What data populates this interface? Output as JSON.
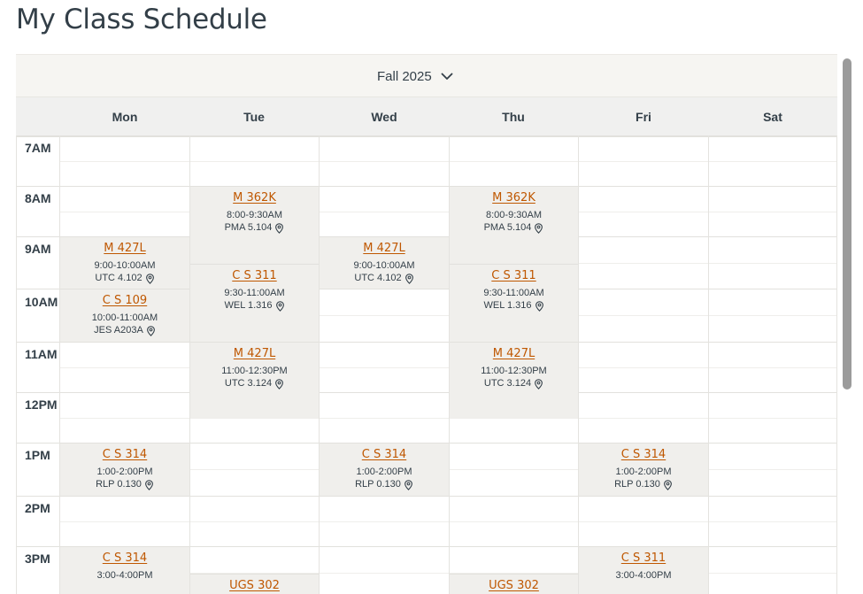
{
  "page": {
    "title": "My Class Schedule"
  },
  "term": {
    "label": "Fall 2025",
    "icon": "chevron-down-icon"
  },
  "days": [
    "Mon",
    "Tue",
    "Wed",
    "Thu",
    "Fri",
    "Sat"
  ],
  "times": [
    "7AM",
    "8AM",
    "9AM",
    "10AM",
    "11AM",
    "12PM",
    "1PM",
    "2PM",
    "3PM"
  ],
  "colors": {
    "accent": "#bf5700",
    "event_bg": "#f0efec",
    "text": "#333f48"
  },
  "events": [
    {
      "title": "M 362K",
      "time": "8:00-9:30AM",
      "location": "PMA 5.104"
    },
    {
      "title": "M 362K",
      "time": "8:00-9:30AM",
      "location": "PMA 5.104"
    },
    {
      "title": "M 427L",
      "time": "9:00-10:00AM",
      "location": "UTC 4.102"
    },
    {
      "title": "M 427L",
      "time": "9:00-10:00AM",
      "location": "UTC 4.102"
    },
    {
      "title": "C S 311",
      "time": "9:30-11:00AM",
      "location": "WEL 1.316"
    },
    {
      "title": "C S 311",
      "time": "9:30-11:00AM",
      "location": "WEL 1.316"
    },
    {
      "title": "C S 109",
      "time": "10:00-11:00AM",
      "location": "JES A203A"
    },
    {
      "title": "M 427L",
      "time": "11:00-12:30PM",
      "location": "UTC 3.124"
    },
    {
      "title": "M 427L",
      "time": "11:00-12:30PM",
      "location": "UTC 3.124"
    },
    {
      "title": "C S 314",
      "time": "1:00-2:00PM",
      "location": "RLP 0.130"
    },
    {
      "title": "C S 314",
      "time": "1:00-2:00PM",
      "location": "RLP 0.130"
    },
    {
      "title": "C S 314",
      "time": "1:00-2:00PM",
      "location": "RLP 0.130"
    },
    {
      "title": "C S 314",
      "time": "3:00-4:00PM",
      "location": ""
    },
    {
      "title": "C S 311",
      "time": "3:00-4:00PM",
      "location": ""
    },
    {
      "title": "UGS 302",
      "time": "",
      "location": ""
    },
    {
      "title": "UGS 302",
      "time": "",
      "location": ""
    }
  ]
}
